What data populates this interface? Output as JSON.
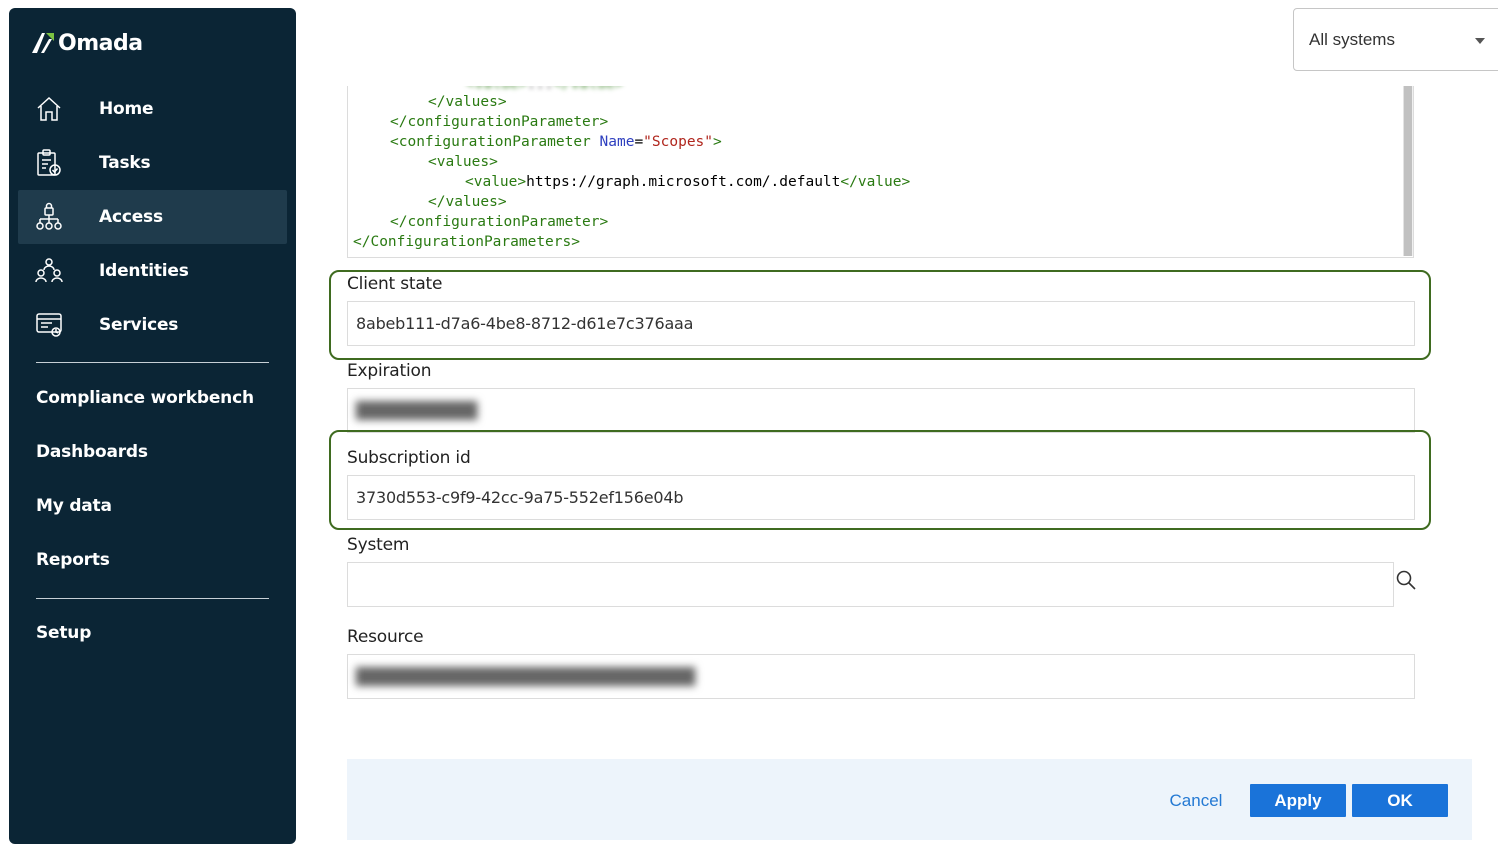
{
  "app": {
    "name": "Omada"
  },
  "sidebar": {
    "items": [
      {
        "label": "Home",
        "icon": "home-icon"
      },
      {
        "label": "Tasks",
        "icon": "tasks-icon"
      },
      {
        "label": "Access",
        "icon": "access-icon",
        "active": true
      },
      {
        "label": "Identities",
        "icon": "identities-icon"
      },
      {
        "label": "Services",
        "icon": "services-icon"
      }
    ],
    "links": [
      {
        "label": "Compliance workbench"
      },
      {
        "label": "Dashboards"
      },
      {
        "label": "My data"
      },
      {
        "label": "Reports"
      }
    ],
    "setup_label": "Setup"
  },
  "system_selector": {
    "value": "All systems"
  },
  "config_xml": {
    "l1a": "</values>",
    "l2a": "</configurationParameter>",
    "l3a": "<configurationParameter ",
    "l3b": "Name",
    "l3c": "=",
    "l3d": "\"Scopes\"",
    "l3e": ">",
    "l4a": "<values>",
    "l5a": "<value>",
    "l5b": "https://graph.microsoft.com/.default",
    "l5c": "</value>",
    "l6a": "</values>",
    "l7a": "</configurationParameter>",
    "l8a": "</ConfigurationParameters>"
  },
  "form": {
    "client_state": {
      "label": "Client state",
      "value": "8abeb111-d7a6-4be8-8712-d61e7c376aaa"
    },
    "expiration": {
      "label": "Expiration"
    },
    "subscription_id": {
      "label": "Subscription id",
      "value": "3730d553-c9f9-42cc-9a75-552ef156e04b"
    },
    "system": {
      "label": "System",
      "value": ""
    },
    "resource": {
      "label": "Resource"
    }
  },
  "buttons": {
    "cancel": "Cancel",
    "apply": "Apply",
    "ok": "OK"
  },
  "colors": {
    "sidebar_bg": "#0b2535",
    "sidebar_active": "#1f3b4c",
    "accent": "#1a73d9",
    "highlight_border": "#3f6b20",
    "footer_bg": "#edf4fb"
  }
}
